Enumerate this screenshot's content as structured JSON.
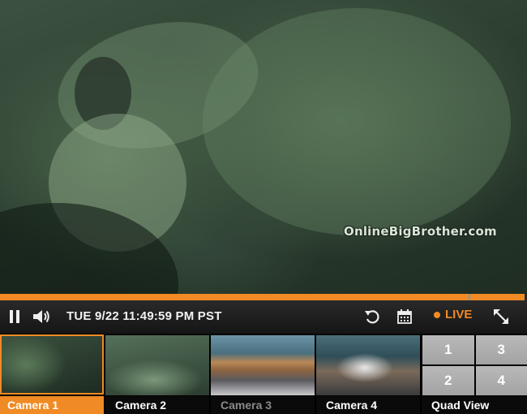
{
  "player": {
    "watermark": "OnlineBigBrother.com",
    "progress_percent": 99.6,
    "timestamp": "TUE 9/22 11:49:59 PM PST",
    "live_label": "LIVE",
    "icons": {
      "pause": "pause-icon",
      "volume": "volume-icon",
      "replay": "replay-icon",
      "calendar": "calendar-icon",
      "fullscreen": "fullscreen-icon"
    },
    "colors": {
      "accent": "#f08a24",
      "night_vision": "#3c5140"
    }
  },
  "cameras": [
    {
      "label": "Camera 1",
      "active": true,
      "dim": false
    },
    {
      "label": "Camera 2",
      "active": false,
      "dim": false
    },
    {
      "label": "Camera 3",
      "active": false,
      "dim": true
    },
    {
      "label": "Camera 4",
      "active": false,
      "dim": false
    }
  ],
  "quad": {
    "label": "Quad View",
    "cells": [
      "1",
      "3",
      "2",
      "4"
    ]
  }
}
